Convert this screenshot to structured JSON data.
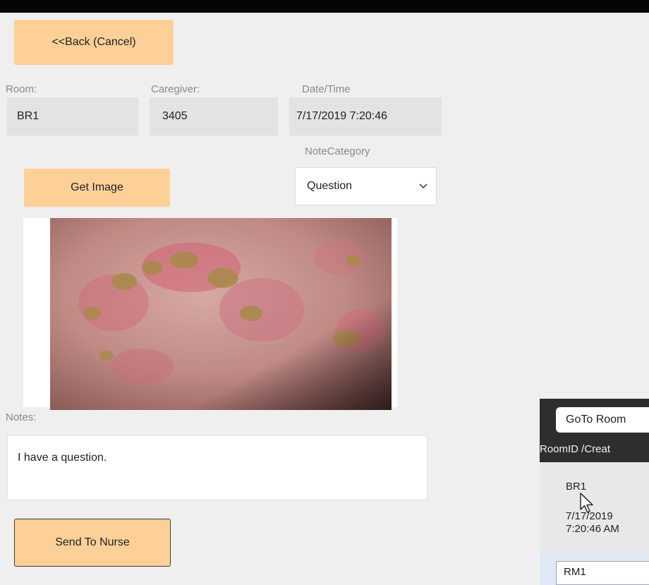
{
  "header": {
    "back_label": "<<Back  (Cancel)"
  },
  "form": {
    "room_label": "Room:",
    "room_value": "BR1",
    "caregiver_label": "Caregiver:",
    "caregiver_value": "3405",
    "datetime_label": "Date/Time",
    "datetime_value": "7/17/2019 7:20:46",
    "note_category_label": "NoteCategory",
    "note_category_value": "Question",
    "get_image_label": "Get Image",
    "notes_label": "Notes:",
    "notes_value": "I have a question.",
    "send_label": "Send To Nurse"
  },
  "room_panel": {
    "goto_label": "GoTo Room",
    "column_header": "RoomID /Creat",
    "items": [
      {
        "room": "BR1",
        "date": "7/17/2019",
        "time": "7:20:46 AM"
      },
      {
        "room": "RM1"
      }
    ]
  },
  "colors": {
    "accent": "#fdd098",
    "dark_bar": "#050505",
    "panel_dark": "#2e2e2e"
  },
  "icons": {
    "dropdown": "chevron-down-icon",
    "cursor": "mouse-pointer-icon"
  }
}
